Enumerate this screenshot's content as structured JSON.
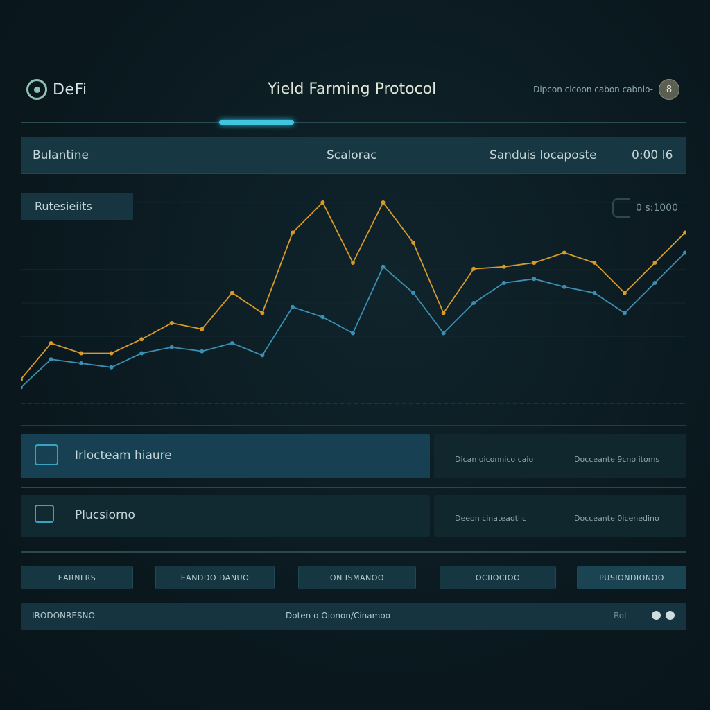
{
  "header": {
    "logo_text": "DeFi",
    "title": "Yield Farming Protocol",
    "wallet_text": "Dipcon cicoon cabon cabnio-",
    "avatar_text": "8"
  },
  "stats_bar": {
    "left_label": "Bulantine",
    "center_label": "Scalorac",
    "right_label": "Sanduis locaposte",
    "right_value": "0:00 I6"
  },
  "chart": {
    "series_label": "Rutesieiits",
    "value_readout": "0 s:1000"
  },
  "chart_data": {
    "type": "line",
    "x": [
      0,
      1,
      2,
      3,
      4,
      5,
      6,
      7,
      8,
      9,
      10,
      11,
      12,
      13,
      14,
      15,
      16,
      17,
      18,
      19,
      20,
      21,
      22
    ],
    "series": [
      {
        "values": [
          12,
          30,
          25,
          25,
          32,
          40,
          37,
          55,
          45,
          85,
          100,
          70,
          100,
          80,
          45,
          67,
          68,
          70,
          75,
          70,
          55,
          70,
          85
        ],
        "color": "#d89a2a"
      },
      {
        "values": [
          8,
          22,
          20,
          18,
          25,
          28,
          26,
          30,
          24,
          48,
          43,
          35,
          68,
          55,
          35,
          50,
          60,
          62,
          58,
          55,
          45,
          60,
          75
        ],
        "color": "#3c8fb4"
      }
    ]
  },
  "rows": [
    {
      "label": "Irlocteam hiaure",
      "side_left": "Dican oiconnico caio",
      "side_right": "Docceante 9cno itoms"
    },
    {
      "label": "Plucsiorno",
      "side_left": "Deeon cinateaotiic",
      "side_right": "Docceante 0icenedino"
    }
  ],
  "buttons": [
    {
      "label": "EARNLRS"
    },
    {
      "label": "EANDDO DANUO"
    },
    {
      "label": "ON ISMANOO"
    },
    {
      "label": "OCIIOCIOO"
    },
    {
      "label": "PUSIONDIONOO"
    }
  ],
  "status_bar": {
    "left": "IRODONRESNO",
    "center": "Doten o Oionon/Cinamoo",
    "right": "Rot"
  },
  "colors": {
    "accent": "#3ec6e0",
    "series_gold": "#d89a2a",
    "series_blue": "#3c8fb4",
    "panel": "#163541"
  }
}
